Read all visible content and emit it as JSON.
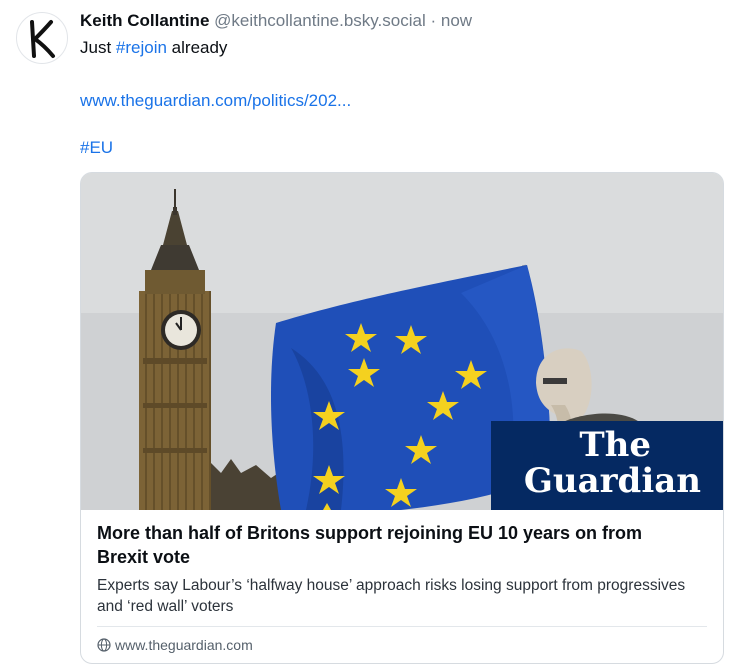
{
  "post": {
    "author_name": "Keith Collantine",
    "author_handle": "@keithcollantine.bsky.social",
    "separator": "·",
    "timestamp": "now",
    "text_prefix": "Just ",
    "hashtag_1": "#rejoin",
    "text_suffix": " already",
    "url_text": "www.theguardian.com/politics/202...",
    "hashtag_2": "#EU",
    "avatar_letter": "K"
  },
  "link_card": {
    "title": "More than half of Britons support rejoining EU 10 years on from Brexit vote",
    "description": "Experts say Labour’s ‘halfway house’ approach risks losing support from progressives and ‘red wall’ voters",
    "domain": "www.theguardian.com",
    "logo_line_1": "The",
    "logo_line_2": "Guardian"
  },
  "colors": {
    "link": "#1a73e8",
    "guardian_navy": "#052962",
    "eu_blue": "#1f4fb8",
    "eu_star": "#f4d11f"
  }
}
